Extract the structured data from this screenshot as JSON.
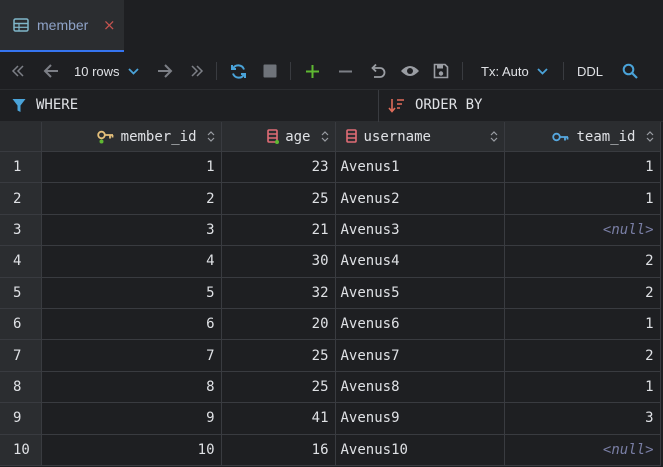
{
  "tab": {
    "label": "member",
    "close_glyph": "×",
    "icon": "table-icon"
  },
  "toolbar": {
    "rows_label": "10 rows",
    "tx_label": "Tx: Auto",
    "ddl_label": "DDL",
    "icons": [
      "first-page-icon",
      "prev-page-icon",
      "next-page-icon",
      "last-page-icon",
      "refresh-icon",
      "stop-icon",
      "add-row-icon",
      "delete-row-icon",
      "revert-icon",
      "preview-icon",
      "submit-icon",
      "search-icon"
    ],
    "colors": {
      "refresh": "#4aa3d9",
      "add": "#5fb832",
      "accent": "#3574f0"
    }
  },
  "filter": {
    "where_label": "WHERE",
    "order_label": "ORDER BY"
  },
  "table": {
    "columns": [
      {
        "key": "member_id",
        "label": "member_id",
        "icon": "primary-key-icon",
        "align": "right"
      },
      {
        "key": "age",
        "label": "age",
        "icon": "column-icon",
        "align": "left"
      },
      {
        "key": "username",
        "label": "username",
        "icon": "column-icon",
        "align": "left"
      },
      {
        "key": "team_id",
        "label": "team_id",
        "icon": "foreign-key-icon",
        "align": "right"
      }
    ],
    "rows": [
      {
        "idx": "1",
        "member_id": "1",
        "age": "23",
        "username": "Avenus1",
        "team_id": "1"
      },
      {
        "idx": "2",
        "member_id": "2",
        "age": "25",
        "username": "Avenus2",
        "team_id": "1"
      },
      {
        "idx": "3",
        "member_id": "3",
        "age": "21",
        "username": "Avenus3",
        "team_id": "<null>"
      },
      {
        "idx": "4",
        "member_id": "4",
        "age": "30",
        "username": "Avenus4",
        "team_id": "2"
      },
      {
        "idx": "5",
        "member_id": "5",
        "age": "32",
        "username": "Avenus5",
        "team_id": "2"
      },
      {
        "idx": "6",
        "member_id": "6",
        "age": "20",
        "username": "Avenus6",
        "team_id": "1"
      },
      {
        "idx": "7",
        "member_id": "7",
        "age": "25",
        "username": "Avenus7",
        "team_id": "2"
      },
      {
        "idx": "8",
        "member_id": "8",
        "age": "25",
        "username": "Avenus8",
        "team_id": "1"
      },
      {
        "idx": "9",
        "member_id": "9",
        "age": "41",
        "username": "Avenus9",
        "team_id": "3"
      },
      {
        "idx": "10",
        "member_id": "10",
        "age": "16",
        "username": "Avenus10",
        "team_id": "<null>"
      }
    ]
  }
}
